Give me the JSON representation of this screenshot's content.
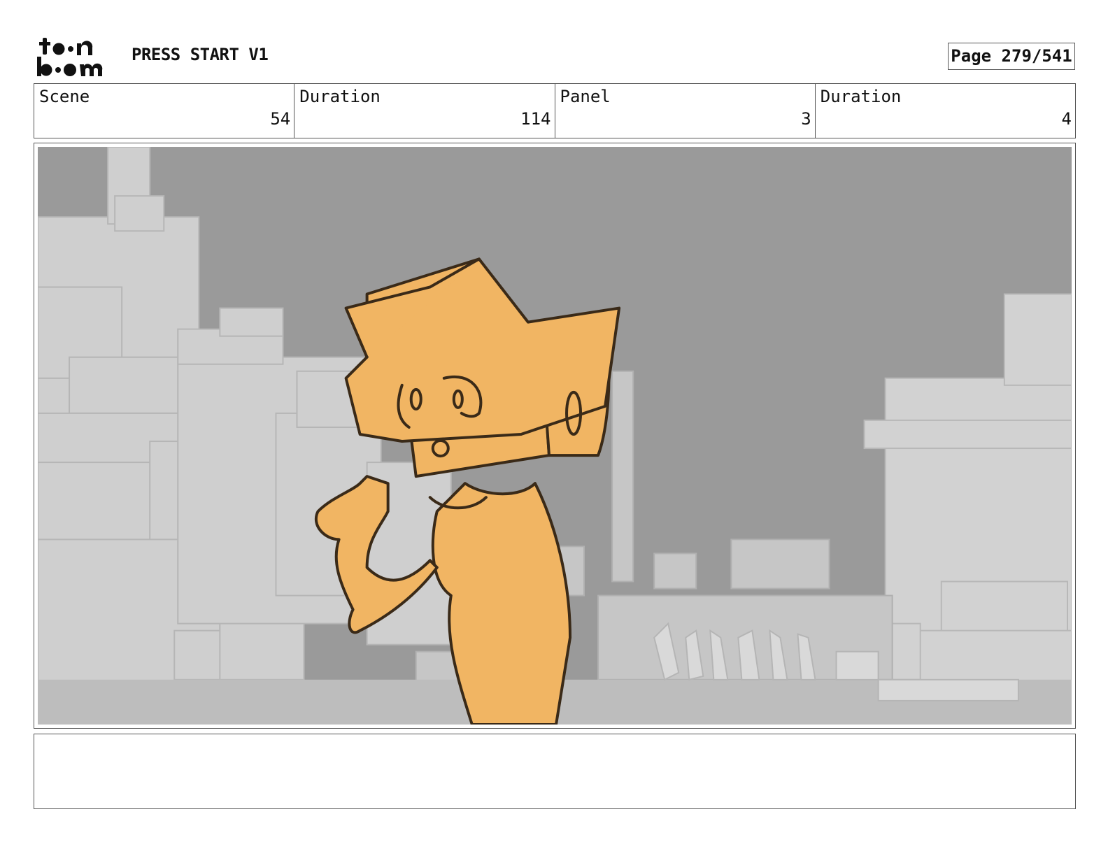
{
  "header": {
    "logo_text_top": "toon",
    "logo_text_bottom": "boom",
    "title": "PRESS START V1",
    "page_label": "Page 279/541"
  },
  "info": [
    {
      "label": "Scene",
      "value": "54"
    },
    {
      "label": "Duration",
      "value": "114"
    },
    {
      "label": "Panel",
      "value": "3"
    },
    {
      "label": "Duration",
      "value": "4"
    }
  ],
  "panel": {
    "image_icon": "storyboard-panel-sketch",
    "sky_color": "#9a9a9a",
    "block_color": "#cfcfcf",
    "character_fill": "#f1b563",
    "line_color": "#3a2a18"
  },
  "notes": {
    "text": ""
  }
}
